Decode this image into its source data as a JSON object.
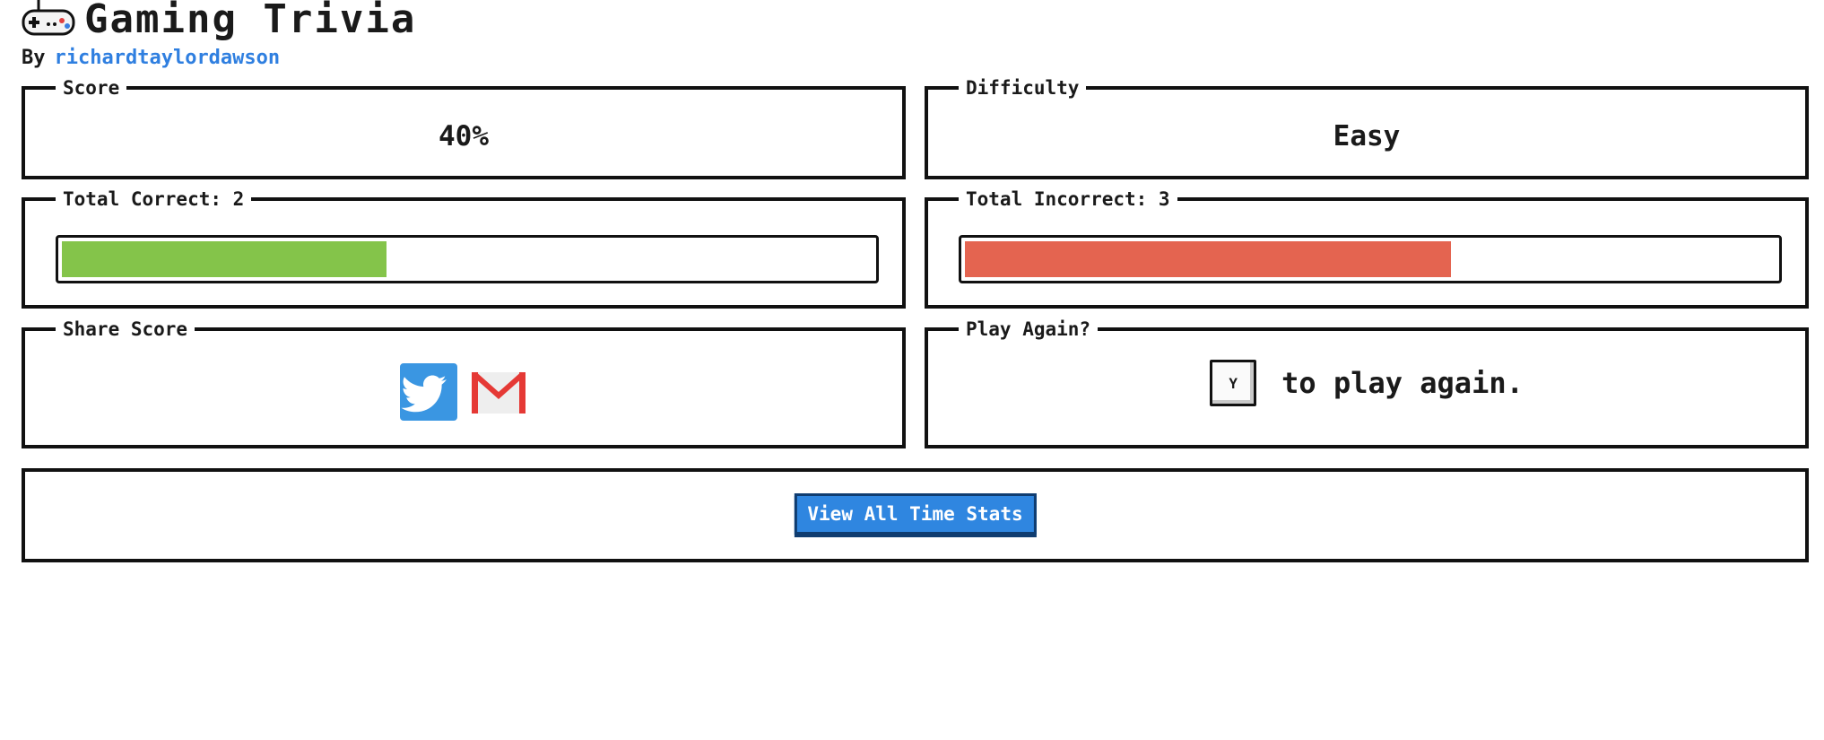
{
  "header": {
    "title": "Gaming Trivia",
    "by_label": "By",
    "author": "richardtaylordawson",
    "icon": "gamepad-icon"
  },
  "score": {
    "label": "Score",
    "value": "40%"
  },
  "difficulty": {
    "label": "Difficulty",
    "value": "Easy"
  },
  "correct": {
    "label": "Total Correct: 2",
    "fraction": 0.4,
    "color": "#84c44a"
  },
  "incorrect": {
    "label": "Total Incorrect: 3",
    "fraction": 0.6,
    "color": "#e46450"
  },
  "share": {
    "label": "Share Score",
    "icons": [
      "twitter-icon",
      "gmail-icon"
    ],
    "twitter_color": "#3a96e2",
    "gmail_color": "#e53935"
  },
  "play_again": {
    "label": "Play Again?",
    "key": "Y",
    "text": "to play again."
  },
  "stats_button": {
    "label": "View All Time Stats",
    "color": "#2f86e0"
  }
}
